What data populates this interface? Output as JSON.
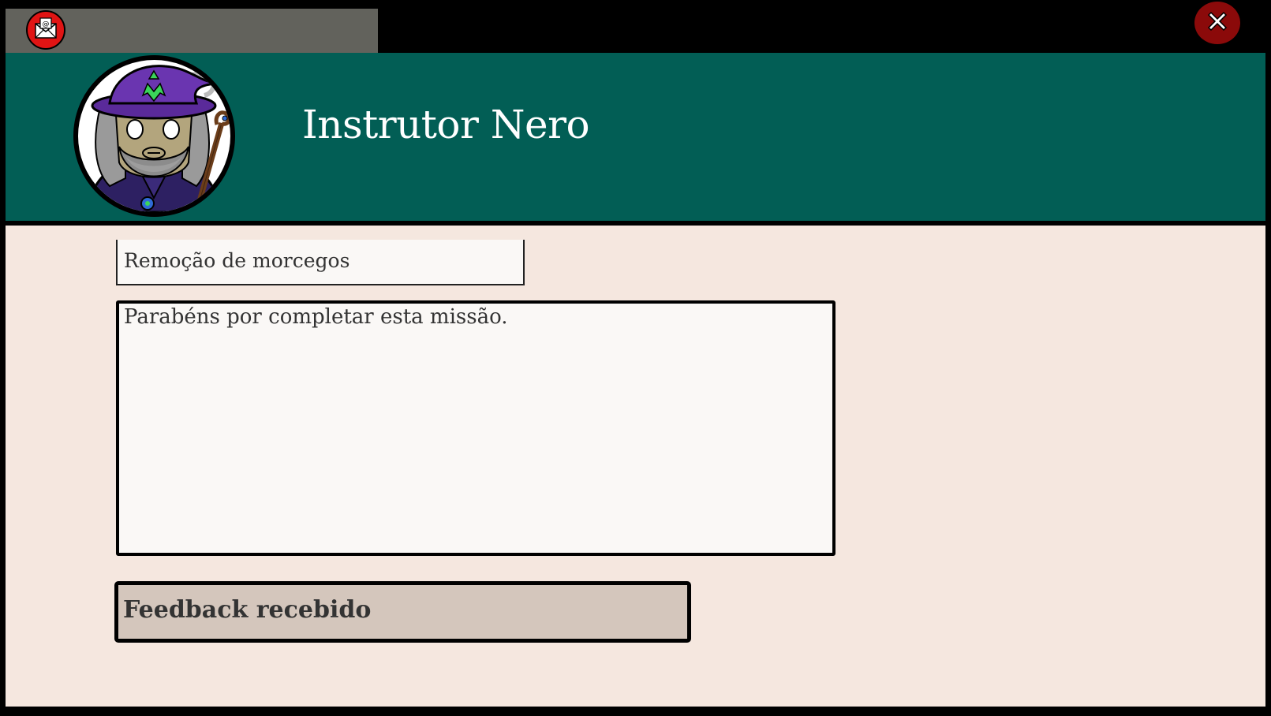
{
  "header": {
    "sender_name": "Instrutor Nero"
  },
  "message": {
    "subject": "Remoção de morcegos",
    "body": "Parabéns por completar esta missão."
  },
  "actions": {
    "feedback_label": "Feedback recebido"
  },
  "icons": {
    "mail": "envelope-at-icon",
    "close": "x-icon",
    "avatar": "wizard-portrait"
  },
  "colors": {
    "header_bg": "#025e55",
    "content_bg": "#f5e7df",
    "tab_bg": "#62625c",
    "mail_button": "#e01414",
    "close_button": "#8b0a0a",
    "feedback_button": "#d4c6bc"
  }
}
